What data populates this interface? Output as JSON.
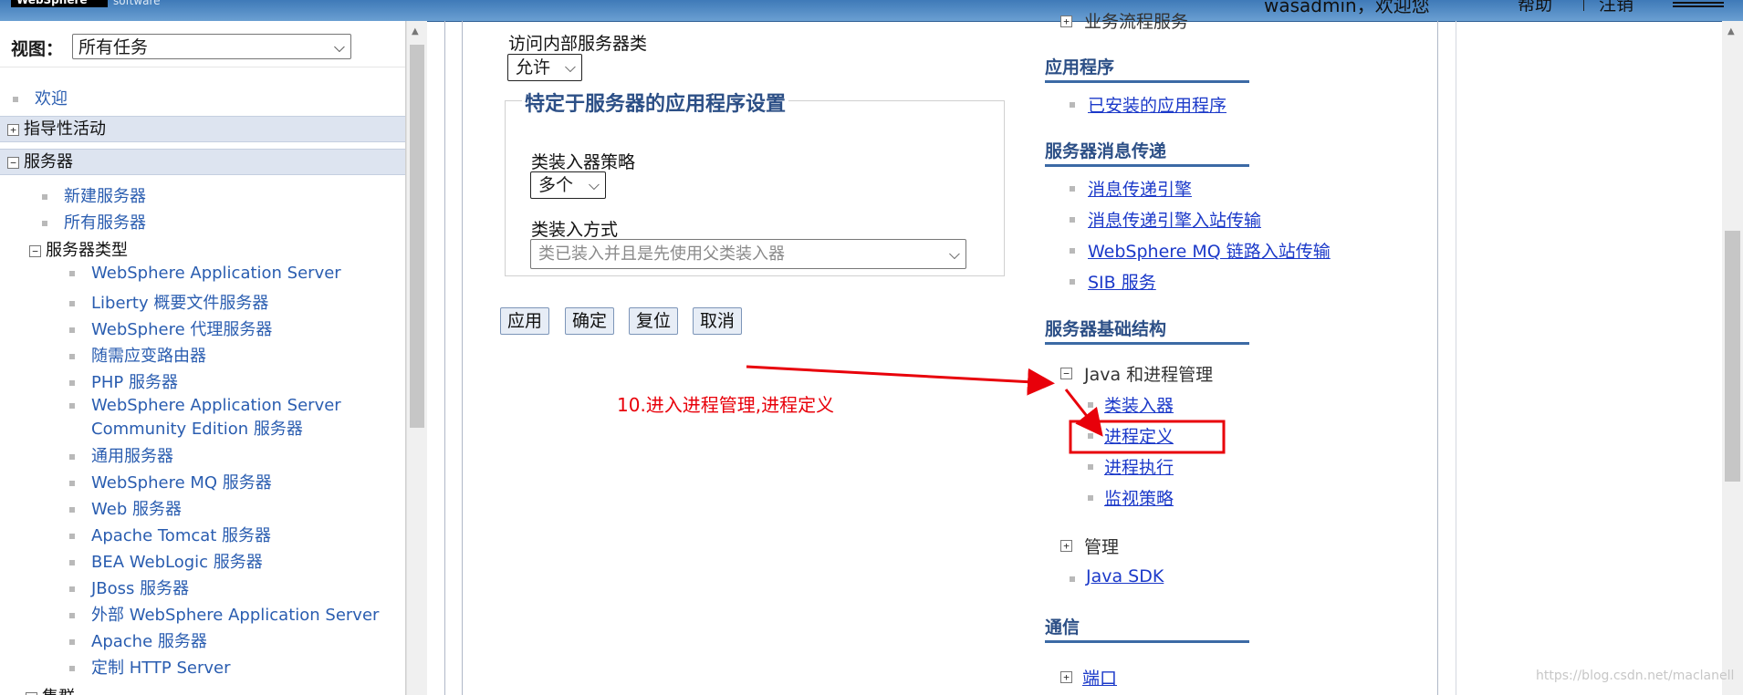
{
  "banner": {
    "brand": "WebSphere",
    "brand_sub": "software",
    "user": "wasadmin，欢迎您",
    "help": "帮助",
    "logout": "注销"
  },
  "leftnav": {
    "view_label": "视图：",
    "view_value": "所有任务",
    "welcome": "欢迎",
    "guided": "指导性活动",
    "servers": "服务器",
    "new_server": "新建服务器",
    "all_servers": "所有服务器",
    "server_types": "服务器类型",
    "types": [
      "WebSphere Application Server",
      "Liberty 概要文件服务器",
      "WebSphere 代理服务器",
      "随需应变路由器",
      "PHP 服务器",
      "WebSphere Application Server",
      "Community Edition 服务器",
      "通用服务器",
      "WebSphere MQ 服务器",
      "Web 服务器",
      "Apache Tomcat 服务器",
      "BEA WebLogic 服务器",
      "JBoss 服务器",
      "外部 WebSphere Application Server",
      "Apache 服务器",
      "定制 HTTP Server"
    ],
    "clusters": "集群"
  },
  "form": {
    "internal_class_access_label": "访问内部服务器类",
    "internal_class_access_value": "允许",
    "fieldset_title": "特定于服务器的应用程序设置",
    "classloader_policy_label": "类装入器策略",
    "classloader_policy_value": "多个",
    "classloading_mode_label": "类装入方式",
    "classloading_mode_value": "类已装入并且是先使用父类装入器",
    "buttons": {
      "apply": "应用",
      "ok": "确定",
      "reset": "复位",
      "cancel": "取消"
    }
  },
  "annotation": {
    "text": "10.进入进程管理,进程定义",
    "color": "#e8000a"
  },
  "tasks": {
    "top_partial": "业务流程服务",
    "applications": "应用程序",
    "installed_apps": "已安装的应用程序",
    "messaging": "服务器消息传递",
    "messaging_engines": "消息传递引擎",
    "messaging_inbound": "消息传递引擎入站传输",
    "mq_inbound": "WebSphere MQ 链路入站传输",
    "sib_service": "SIB 服务",
    "infrastructure": "服务器基础结构",
    "java_process": "Java 和进程管理",
    "classloader": "类装入器",
    "process_definition": "进程定义",
    "process_execution": "进程执行",
    "monitoring_policy": "监视策略",
    "administration": "管理",
    "java_sdk": "Java SDK",
    "communications": "通信",
    "ports": "端口"
  },
  "watermark": "https://blog.csdn.net/maclanell"
}
